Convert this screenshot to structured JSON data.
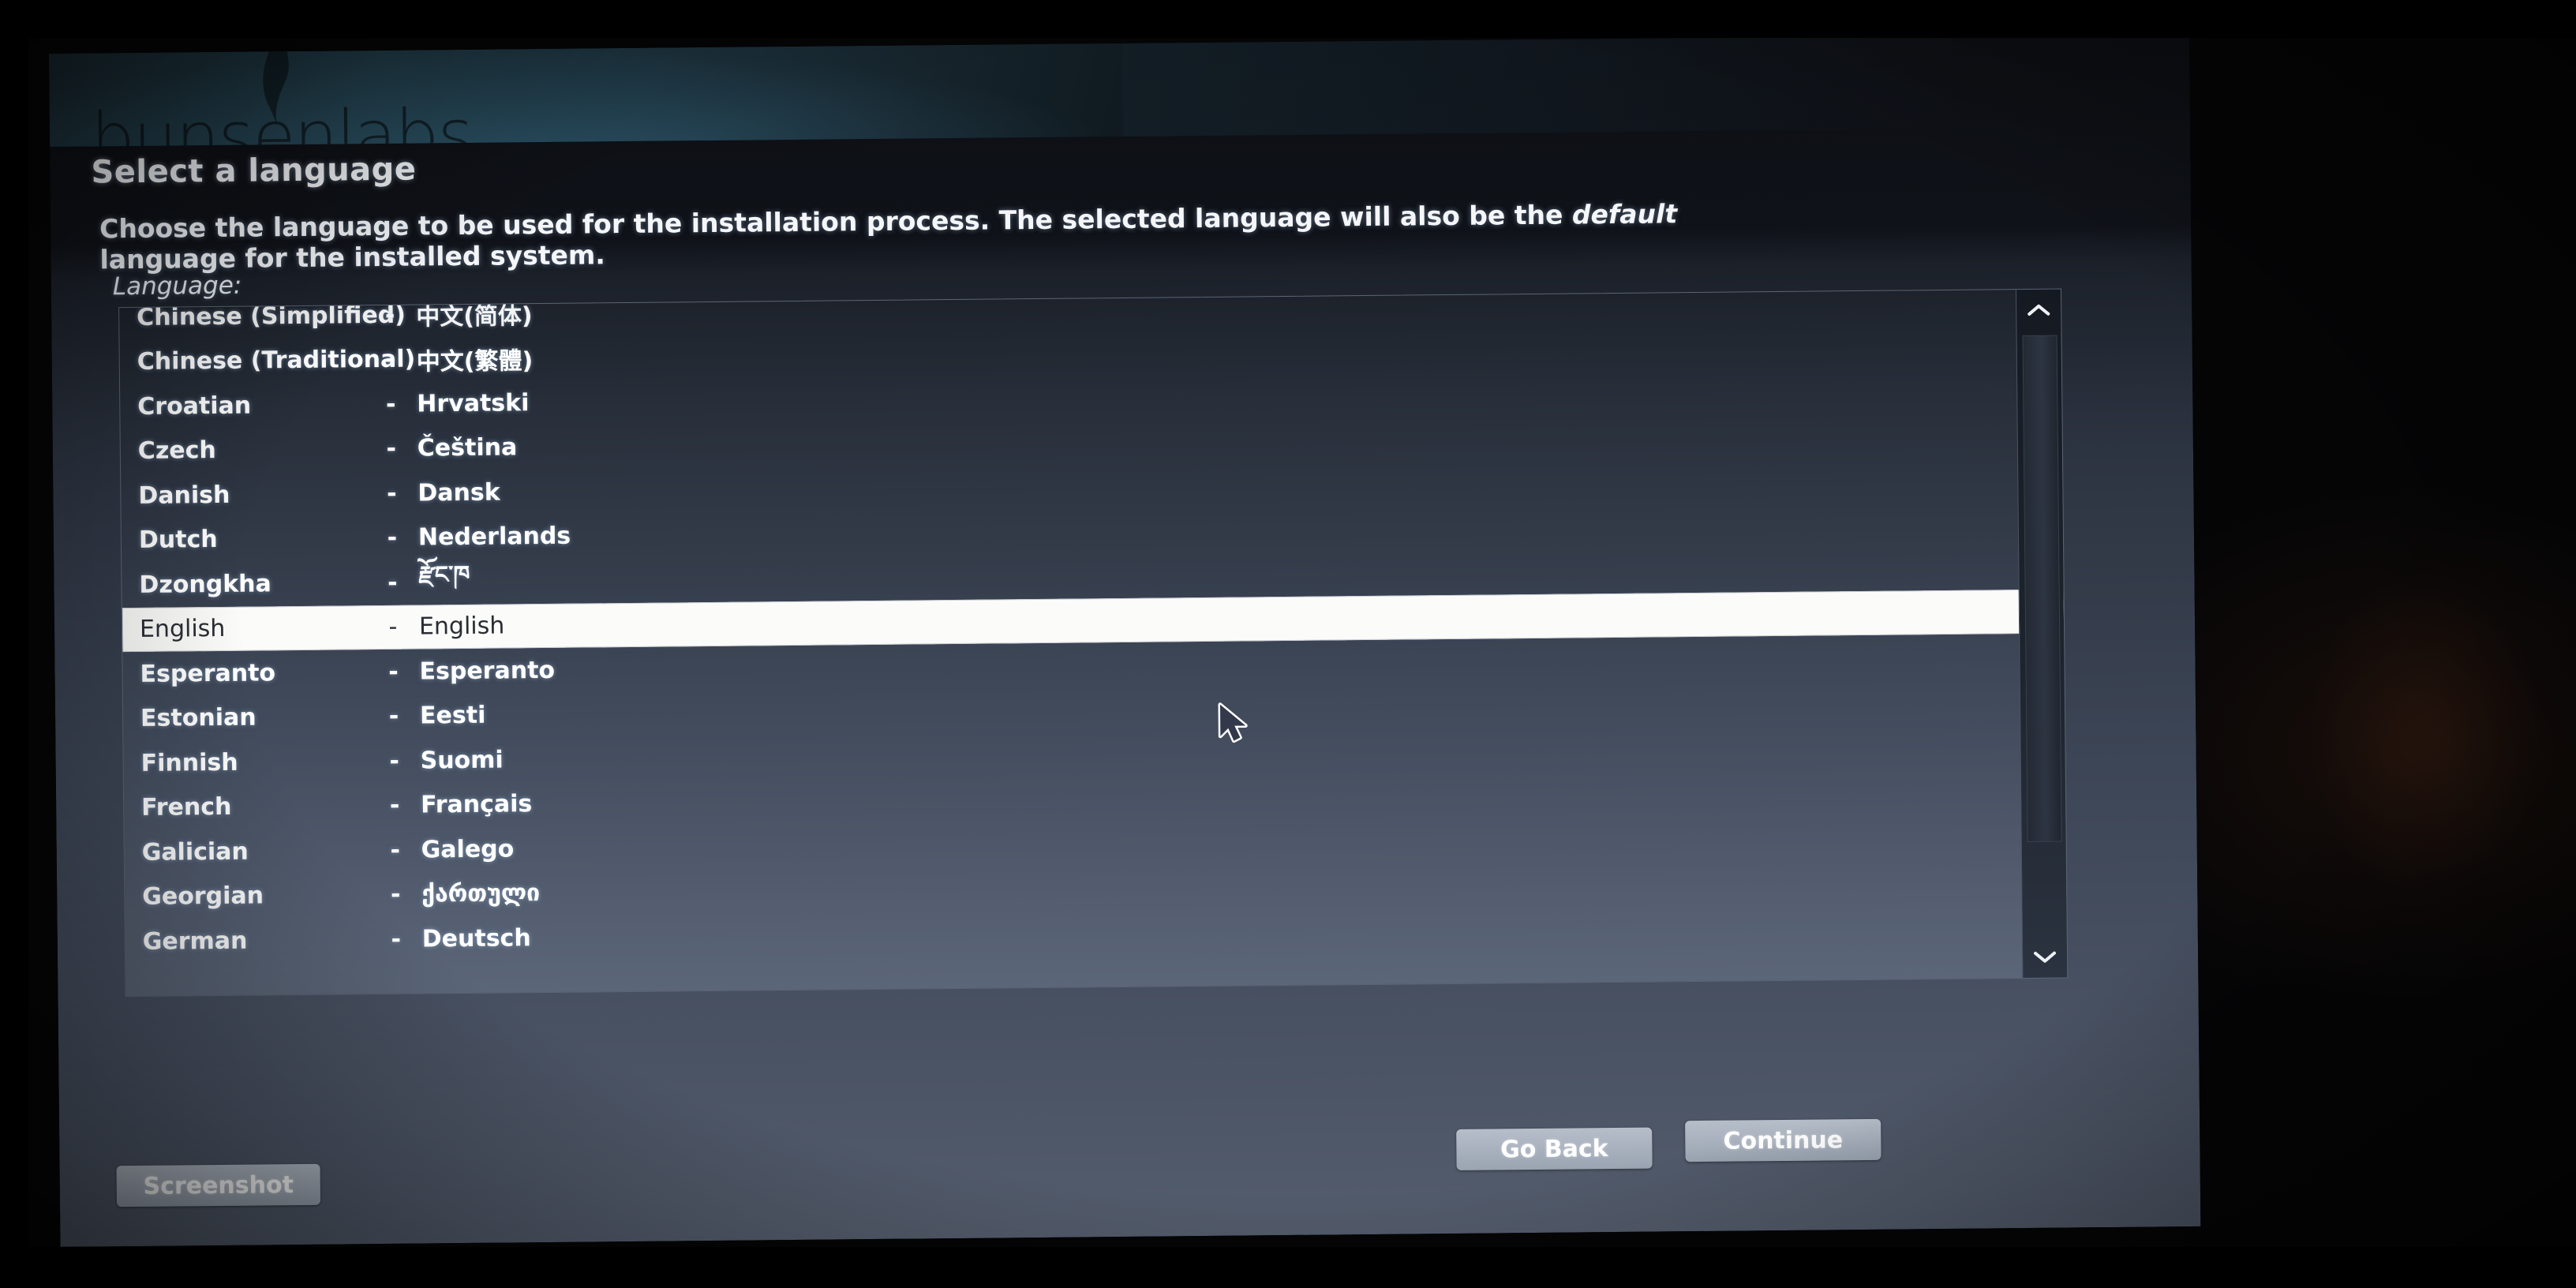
{
  "banner": {
    "wordmark": "bunsenlabs",
    "logo_icon": "bunsen-flame-icon"
  },
  "page_title": "Select a language",
  "description_line1": "Choose the language to be used for the installation process. The selected language will also be the ",
  "description_emphasis": "default",
  "description_line2": "language for the installed system.",
  "field_label": "Language:",
  "list": {
    "separator": "-",
    "selected_index": 7,
    "rows": [
      {
        "english": "Chinese (Simplified)",
        "native": "中文(简体)"
      },
      {
        "english": "Chinese (Traditional)",
        "native": "中文(繁體)"
      },
      {
        "english": "Croatian",
        "native": "Hrvatski"
      },
      {
        "english": "Czech",
        "native": "Čeština"
      },
      {
        "english": "Danish",
        "native": "Dansk"
      },
      {
        "english": "Dutch",
        "native": "Nederlands"
      },
      {
        "english": "Dzongkha",
        "native": "རྫོང་ཁ"
      },
      {
        "english": "English",
        "native": "English"
      },
      {
        "english": "Esperanto",
        "native": "Esperanto"
      },
      {
        "english": "Estonian",
        "native": "Eesti"
      },
      {
        "english": "Finnish",
        "native": "Suomi"
      },
      {
        "english": "French",
        "native": "Français"
      },
      {
        "english": "Galician",
        "native": "Galego"
      },
      {
        "english": "Georgian",
        "native": "ქართული"
      },
      {
        "english": "German",
        "native": "Deutsch"
      }
    ]
  },
  "scrollbar": {
    "up_arrow_icon": "chevron-up-icon",
    "down_arrow_icon": "chevron-down-icon"
  },
  "buttons": {
    "screenshot": "Screenshot",
    "go_back": "Go Back",
    "continue": "Continue"
  },
  "cursor_icon": "arrow-pointer-icon",
  "colors": {
    "selection_bg": "#fbfbf9",
    "selection_text": "#2a2d33",
    "panel_top": "#1b2029",
    "panel_bottom": "#545d6d",
    "button_face": "#a8b1bd",
    "banner_teal": "#203b47"
  }
}
